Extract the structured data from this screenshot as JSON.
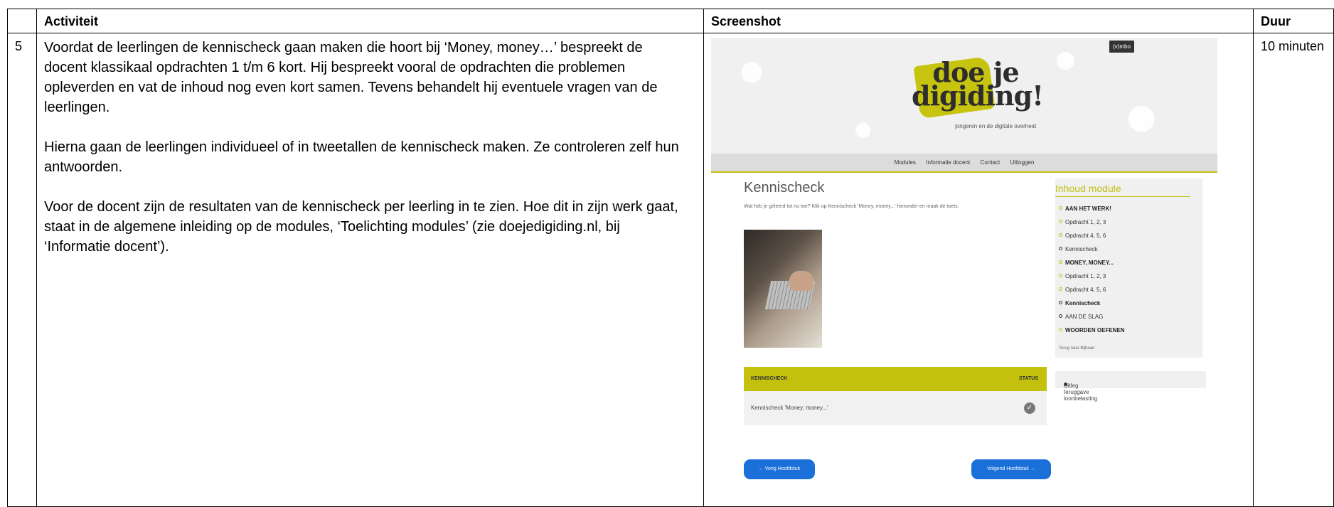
{
  "table": {
    "headers": {
      "activiteit": "Activiteit",
      "screenshot": "Screenshot",
      "duur": "Duur"
    },
    "row": {
      "number": "5",
      "paragraphs": [
        "Voordat de leerlingen de kennischeck gaan maken die hoort bij ‘Money, money…’ bespreekt de docent klassikaal opdrachten 1 t/m 6 kort. Hij bespreekt vooral de opdrachten die problemen opleverden en vat de inhoud nog even kort samen. Tevens behandelt hij eventuele vragen van de leerlingen.",
        "Hierna gaan de leerlingen individueel of in tweetallen de kennischeck maken. Ze controleren zelf hun antwoorden.",
        "Voor de docent zijn de resultaten van de kennischeck per leerling in te zien. Hoe dit in zijn werk gaat, staat in de algemene inleiding op de modules, ‘Toelichting modules’ (zie doejedigiding.nl, bij ‘Informatie docent’)."
      ],
      "duur": "10 minuten"
    }
  },
  "screenshot": {
    "badge": "(v)mbo",
    "logo_line1": "doe je",
    "logo_line2": "digiding!",
    "logo_sub": "jongeren en de digitale overheid",
    "nav": [
      "Modules",
      "Informatie docent",
      "Contact",
      "Uitloggen"
    ],
    "title": "Kennischeck",
    "intro": "Wat heb je geleerd tot nu toe? Klik op Kennischeck 'Money, money...' hieronder en maak de toets.",
    "sidebar": {
      "title": "Inhoud module",
      "items": [
        {
          "label": "AAN HET WERK!"
        },
        {
          "label": "Opdracht 1, 2, 3"
        },
        {
          "label": "Opdracht 4, 5, 6"
        },
        {
          "label": "Kennischeck"
        },
        {
          "label": "MONEY, MONEY..."
        },
        {
          "label": "Opdracht 1, 2, 3"
        },
        {
          "label": "Opdracht 4, 5, 6"
        },
        {
          "label": "Kennischeck"
        },
        {
          "label": "AAN DE SLAG"
        },
        {
          "label": "WOORDEN OEFENEN"
        }
      ],
      "back": "Terug naar Bijbaan"
    },
    "kc_table": {
      "col1": "KENNISCHECK",
      "col2": "STATUS",
      "row_label": "Kennischeck 'Money, money...'"
    },
    "uitleg": "Uitleg teruggave loonbelasting",
    "btn_prev": "← Vorig Hoofdstuk",
    "btn_next": "Volgend Hoofdstuk →",
    "colors": {
      "accent": "#c3c00e",
      "button": "#1a6fd8"
    }
  }
}
